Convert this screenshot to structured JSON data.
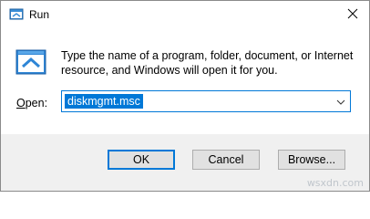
{
  "window": {
    "title": "Run"
  },
  "dialog": {
    "description": "Type the name of a program, folder, document, or Internet resource, and Windows will open it for you.",
    "open_label_prefix": "",
    "open_label_accel": "O",
    "open_label_rest": "pen:",
    "open_value": "diskmgmt.msc"
  },
  "buttons": {
    "ok": "OK",
    "cancel": "Cancel",
    "browse": "Browse..."
  },
  "watermark": "wsxdn.com",
  "icons": {
    "title": "run-icon",
    "dialog": "run-icon",
    "close": "close-icon",
    "dropdown": "chevron-down-icon"
  },
  "colors": {
    "accent": "#0078d7",
    "footer": "#f0f0f0"
  }
}
